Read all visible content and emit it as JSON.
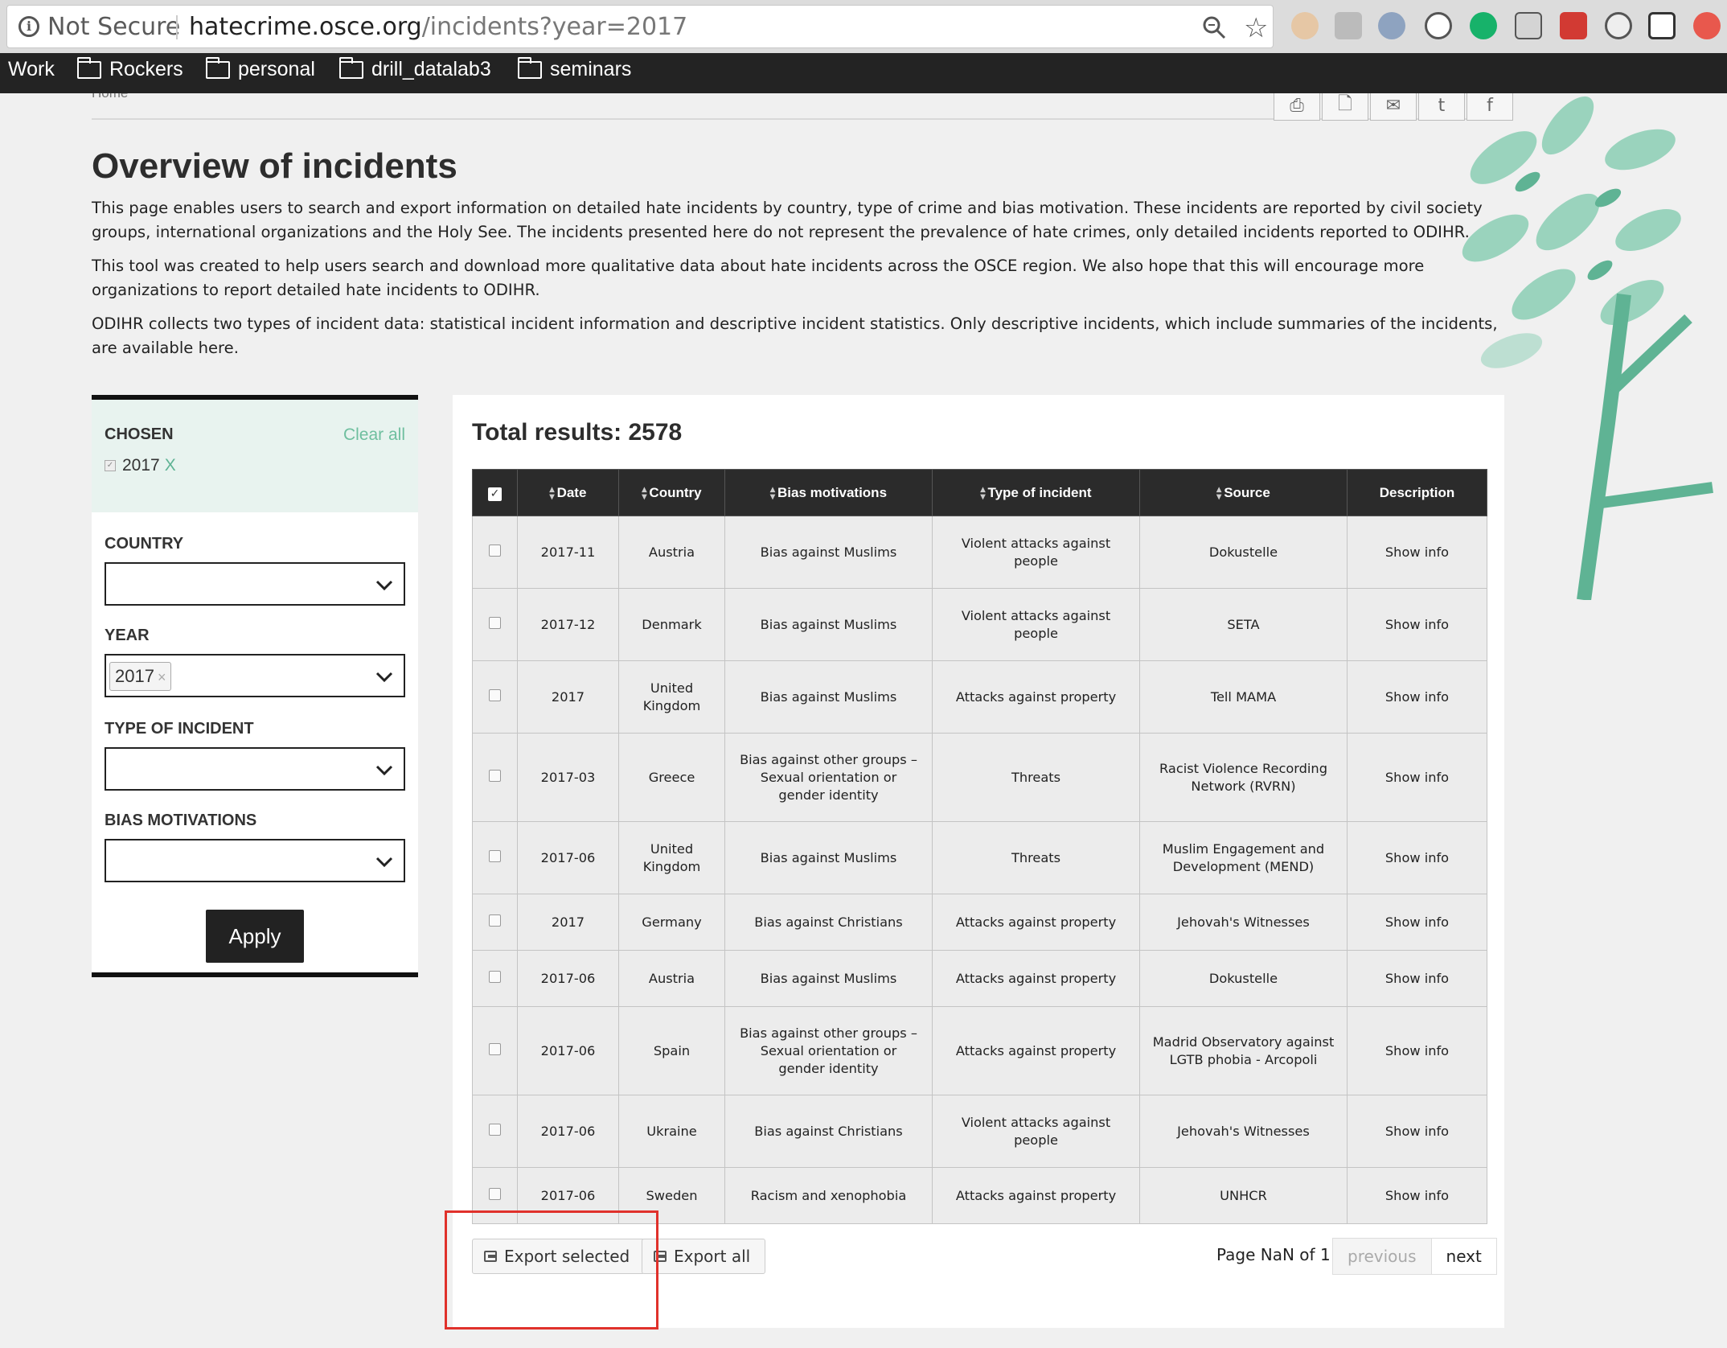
{
  "browser": {
    "secure_label": "Not Secure",
    "url_host": "hatecrime.osce.org",
    "url_path": "/incidents?year=2017",
    "bookmarks": [
      "Work",
      "Rockers",
      "personal",
      "drill_datalab3",
      "seminars"
    ]
  },
  "page": {
    "breadcrumb": "Home",
    "title": "Overview of incidents",
    "paragraphs": [
      "This page enables users to search and export information on detailed hate incidents by country, type of crime and bias motivation. These incidents are reported by civil society groups, international organizations and the Holy See. The incidents presented here do not represent the prevalence of hate crimes, only detailed incidents reported to ODIHR.",
      "This tool was created to help users search and download more qualitative data about hate incidents across the OSCE region. We also hope that this will encourage more organizations to report detailed hate incidents to ODIHR.",
      "ODIHR collects two types of incident data: statistical incident information and descriptive incident statistics. Only descriptive incidents, which include summaries of the incidents, are available here."
    ]
  },
  "filters": {
    "chosen_label": "CHOSEN",
    "clear_all": "Clear all",
    "chosen_value": "2017",
    "chosen_remove": "X",
    "country_label": "COUNTRY",
    "year_label": "YEAR",
    "year_tag": "2017",
    "type_label": "TYPE OF INCIDENT",
    "bias_label": "BIAS MOTIVATIONS",
    "apply_label": "Apply"
  },
  "results": {
    "total_label": "Total results: 2578",
    "columns": [
      "Date",
      "Country",
      "Bias motivations",
      "Type of incident",
      "Source",
      "Description"
    ],
    "rows": [
      [
        "2017-11",
        "Austria",
        "Bias against Muslims",
        "Violent attacks against people",
        "Dokustelle",
        "Show info"
      ],
      [
        "2017-12",
        "Denmark",
        "Bias against Muslims",
        "Violent attacks against people",
        "SETA",
        "Show info"
      ],
      [
        "2017",
        "United Kingdom",
        "Bias against Muslims",
        "Attacks against property",
        "Tell MAMA",
        "Show info"
      ],
      [
        "2017-03",
        "Greece",
        "Bias against other groups – Sexual orientation or gender identity",
        "Threats",
        "Racist Violence Recording Network (RVRN)",
        "Show info"
      ],
      [
        "2017-06",
        "United Kingdom",
        "Bias against Muslims",
        "Threats",
        "Muslim Engagement and Development (MEND)",
        "Show info"
      ],
      [
        "2017",
        "Germany",
        "Bias against Christians",
        "Attacks against property",
        "Jehovah's Witnesses",
        "Show info"
      ],
      [
        "2017-06",
        "Austria",
        "Bias against Muslims",
        "Attacks against property",
        "Dokustelle",
        "Show info"
      ],
      [
        "2017-06",
        "Spain",
        "Bias against other groups – Sexual orientation or gender identity",
        "Attacks against property",
        "Madrid Observatory against LGTB phobia - Arcopoli",
        "Show info"
      ],
      [
        "2017-06",
        "Ukraine",
        "Bias against Christians",
        "Violent attacks against people",
        "Jehovah's Witnesses",
        "Show info"
      ],
      [
        "2017-06",
        "Sweden",
        "Racism and xenophobia",
        "Attacks against property",
        "UNHCR",
        "Show info"
      ]
    ],
    "export_selected": "Export selected",
    "export_all": "Export all",
    "page_info": "Page NaN of 1",
    "previous": "previous",
    "next": "next"
  },
  "colors": {
    "accent_green": "#5fb394",
    "header_dark": "#2b2b2b",
    "highlight_red": "#e0312b"
  }
}
